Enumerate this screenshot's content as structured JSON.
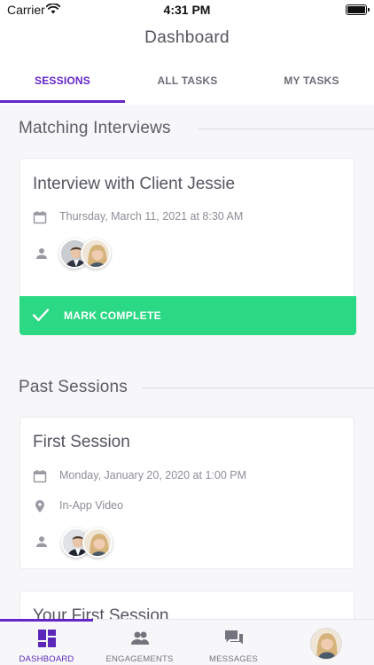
{
  "status_bar": {
    "carrier": "Carrier",
    "time": "4:31 PM"
  },
  "nav": {
    "title": "Dashboard"
  },
  "tabs": [
    {
      "label": "SESSIONS",
      "active": true
    },
    {
      "label": "ALL TASKS",
      "active": false
    },
    {
      "label": "MY TASKS",
      "active": false
    }
  ],
  "matching": {
    "title": "Matching Interviews",
    "card": {
      "title": "Interview with Client Jessie",
      "datetime": "Thursday, March 11, 2021 at 8:30 AM",
      "action_label": "MARK COMPLETE",
      "action_color": "#2bd884"
    }
  },
  "past": {
    "title": "Past Sessions",
    "cards": [
      {
        "title": "First Session",
        "datetime": "Monday, January 20, 2020 at 1:00 PM",
        "location": "In-App Video"
      },
      {
        "title": "Your First Session"
      }
    ]
  },
  "bottom_nav": [
    {
      "label": "DASHBOARD",
      "icon": "dashboard-icon",
      "active": true
    },
    {
      "label": "ENGAGEMENTS",
      "icon": "people-icon",
      "active": false
    },
    {
      "label": "MESSAGES",
      "icon": "chat-icon",
      "active": false
    },
    {
      "label": "",
      "icon": "profile-avatar",
      "active": false
    }
  ],
  "colors": {
    "accent": "#6526c9",
    "success": "#2bd884",
    "background": "#f7f7f9"
  }
}
